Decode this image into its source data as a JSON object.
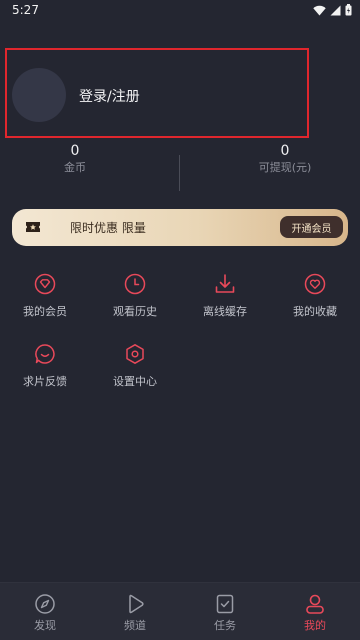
{
  "status_bar": {
    "time": "5:27"
  },
  "profile": {
    "login_label": "登录/注册"
  },
  "stats": {
    "coins": {
      "value": "0",
      "label": "金币"
    },
    "withdraw": {
      "value": "0",
      "label": "可提现(元)"
    }
  },
  "vip_banner": {
    "text": "限时优惠 限量",
    "button_label": "开通会员"
  },
  "menu": [
    {
      "label": "我的会员",
      "icon": "diamond-icon"
    },
    {
      "label": "观看历史",
      "icon": "clock-icon"
    },
    {
      "label": "离线缓存",
      "icon": "download-icon"
    },
    {
      "label": "我的收藏",
      "icon": "heart-icon"
    },
    {
      "label": "求片反馈",
      "icon": "smile-chat-icon"
    },
    {
      "label": "设置中心",
      "icon": "settings-icon"
    }
  ],
  "bottom_nav": [
    {
      "label": "发现",
      "icon": "compass-icon",
      "active": false
    },
    {
      "label": "频道",
      "icon": "play-icon",
      "active": false
    },
    {
      "label": "任务",
      "icon": "task-icon",
      "active": false
    },
    {
      "label": "我的",
      "icon": "user-icon",
      "active": true
    }
  ],
  "colors": {
    "accent": "#e8495a",
    "background": "#242631",
    "highlight_box": "#e0262d"
  }
}
